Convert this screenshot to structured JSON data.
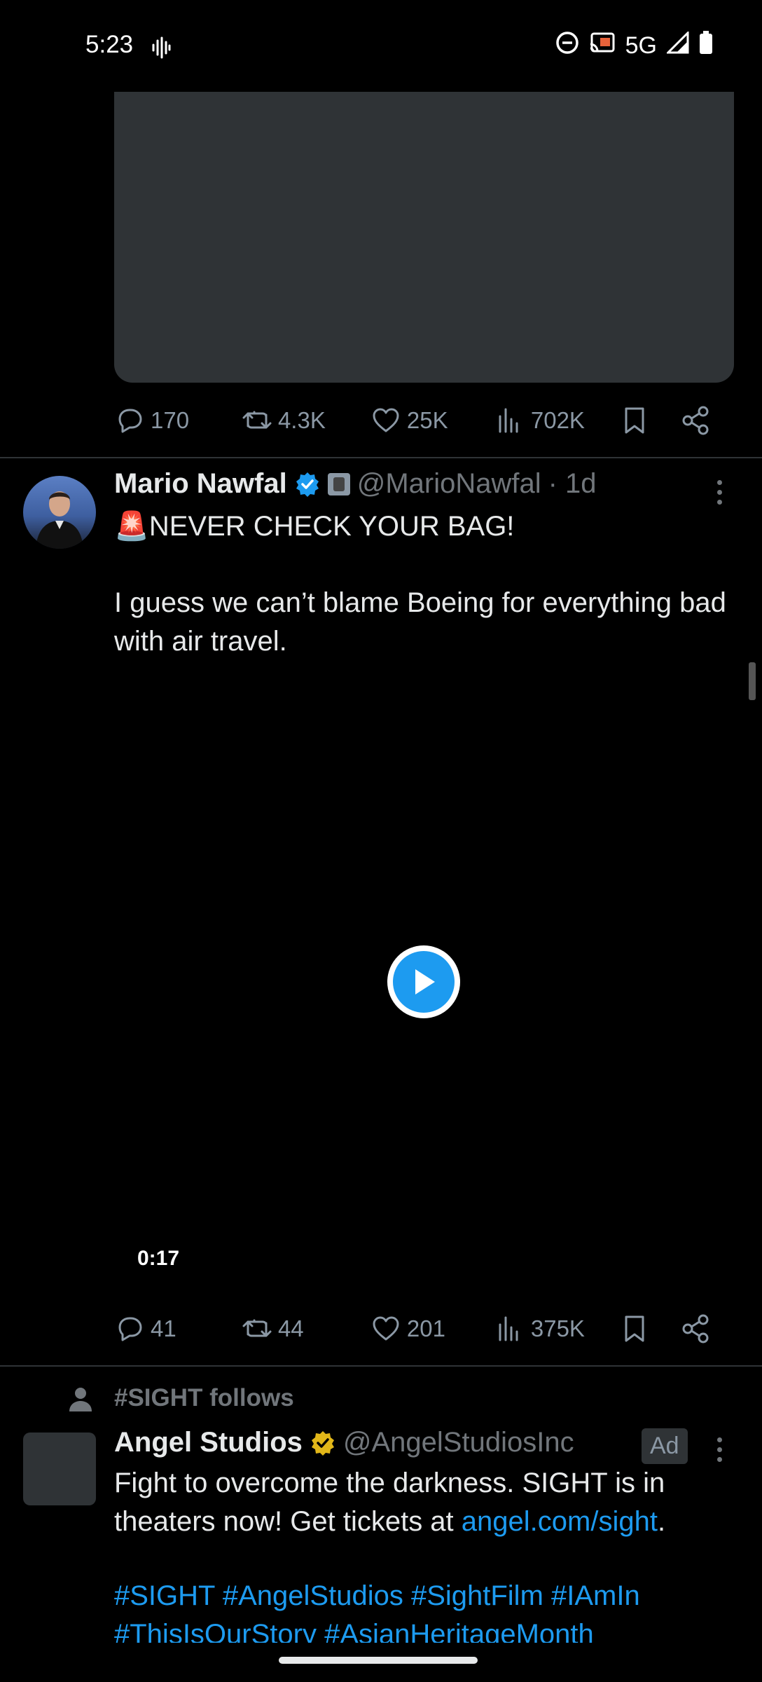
{
  "status_bar": {
    "time": "5:23",
    "network": "5G"
  },
  "post1": {
    "stats": {
      "replies": "170",
      "reposts": "4.3K",
      "likes": "25K",
      "views": "702K"
    }
  },
  "post2": {
    "name": "Mario Nawfal",
    "handle": "@MarioNawfal",
    "time": "· 1d",
    "headline_emoji": "🚨",
    "headline": "NEVER CHECK YOUR BAG!",
    "body": "I guess we can’t blame Boeing for everything bad with air travel.",
    "video_duration": "0:17",
    "stats": {
      "replies": "41",
      "reposts": "44",
      "likes": "201",
      "views": "375K"
    }
  },
  "post3": {
    "context": "#SIGHT follows",
    "name": "Angel Studios",
    "handle": "@AngelStudiosInc",
    "ad_label": "Ad",
    "body_before_link": "Fight to overcome the darkness. SIGHT is in theaters now! Get tickets at ",
    "link": "angel.com/sight",
    "body_after_link": ".",
    "hashtags_line1": "#SIGHT #AngelStudios #SightFilm #IAmIn",
    "hashtags_line2": "#ThisIsOurStory #AsianHeritageMonth"
  },
  "colors": {
    "accent": "#1d9bf0",
    "verified_blue": "#1d9bf0",
    "verified_gold": "#e2b719",
    "background": "#000000"
  }
}
